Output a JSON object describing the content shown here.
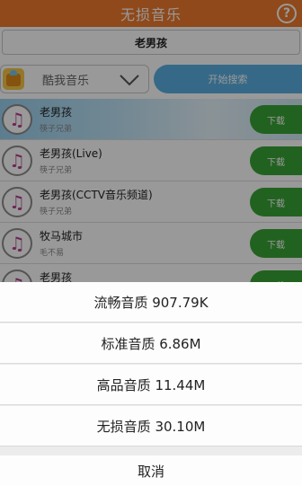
{
  "topbar": {
    "title": "无损音乐",
    "help_icon": "question-icon"
  },
  "search": {
    "query": "老男孩"
  },
  "source": {
    "label": "酷我音乐",
    "search_button": "开始搜索"
  },
  "results": [
    {
      "title": "老男孩",
      "artist": "筷子兄弟",
      "download": "下载"
    },
    {
      "title": "老男孩(Live)",
      "artist": "筷子兄弟",
      "download": "下载"
    },
    {
      "title": "老男孩(CCTV音乐频道)",
      "artist": "筷子兄弟",
      "download": "下载"
    },
    {
      "title": "牧马城市",
      "artist": "毛不易",
      "download": "下载"
    },
    {
      "title": "老男孩",
      "artist": "",
      "download": "下载"
    }
  ],
  "sheet": {
    "options": [
      "流畅音质 907.79K",
      "标准音质 6.86M",
      "高品音质 11.44M",
      "无损音质 30.10M"
    ],
    "cancel": "取消"
  },
  "colors": {
    "topbar": "#ee7a2c",
    "search_button": "#5ab0e2",
    "download_button": "#3aa336"
  }
}
